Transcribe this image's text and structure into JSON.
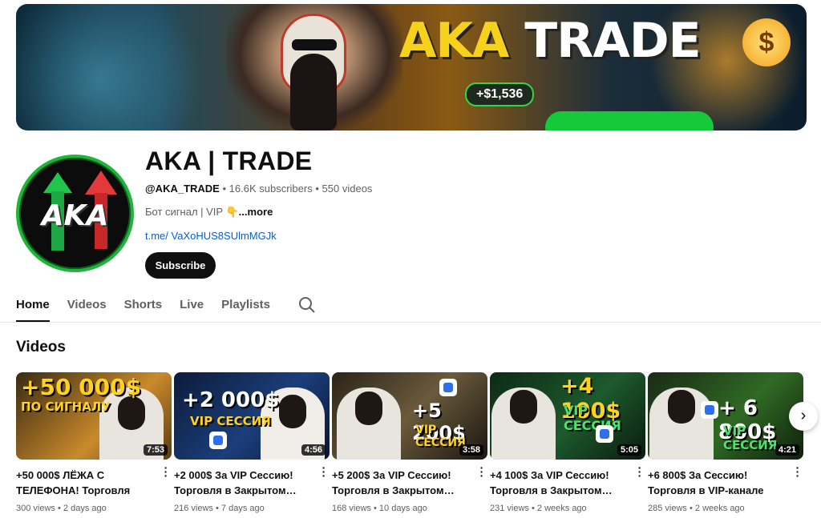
{
  "banner": {
    "title_aka": "AKA",
    "title_trade": "TRADE",
    "profit": "+$1,536",
    "coin": "$"
  },
  "channel": {
    "avatar_text": "AKA",
    "name": "AKA | TRADE",
    "handle": "@AKA_TRADE",
    "subscribers": "16.6K subscribers",
    "videos_count": "550 videos",
    "description": "Бот сигнал  | VIP 👇",
    "more": "...more",
    "link": "t.me/ VaXoHUS8SUlmMGJk",
    "subscribe_label": "Subscribe"
  },
  "tabs": [
    {
      "label": "Home",
      "active": true
    },
    {
      "label": "Videos"
    },
    {
      "label": "Shorts"
    },
    {
      "label": "Live"
    },
    {
      "label": "Playlists"
    }
  ],
  "section_title": "Videos",
  "videos": [
    {
      "thumb_line1": "+50 000$",
      "thumb_line2": "ПО СИГНАЛУ",
      "duration": "7:53",
      "title": "+50 000$ ЛЁЖА С ТЕЛЕФОНА! Торговля по…",
      "views": "300 views",
      "age": "2 days ago"
    },
    {
      "thumb_line1": "+2 000$",
      "thumb_line2": "VIP СЕССИЯ",
      "duration": "4:56",
      "title": "+2 000$ За VIP Сессию! Торговля в Закрытом…",
      "views": "216 views",
      "age": "7 days ago"
    },
    {
      "thumb_line1": "+5 200$",
      "thumb_line2": "VIP СЕССИЯ",
      "duration": "3:58",
      "title": "+5 200$ За VIP Сессию! Торговля в Закрытом…",
      "views": "168 views",
      "age": "10 days ago"
    },
    {
      "thumb_line1": "+4 100$",
      "thumb_line2": "VIP СЕССИЯ",
      "duration": "5:05",
      "title": "+4 100$ За VIP Сессию! Торговля в Закрытом…",
      "views": "231 views",
      "age": "2 weeks ago"
    },
    {
      "thumb_line1": "+ 6 800$",
      "thumb_line2": "VIP СЕССИЯ",
      "duration": "4:21",
      "title": "+6 800$ За Сессию! Торговля в VIP-канале на…",
      "views": "285 views",
      "age": "2 weeks ago"
    }
  ],
  "meta_separator": "•",
  "next_icon": "›"
}
